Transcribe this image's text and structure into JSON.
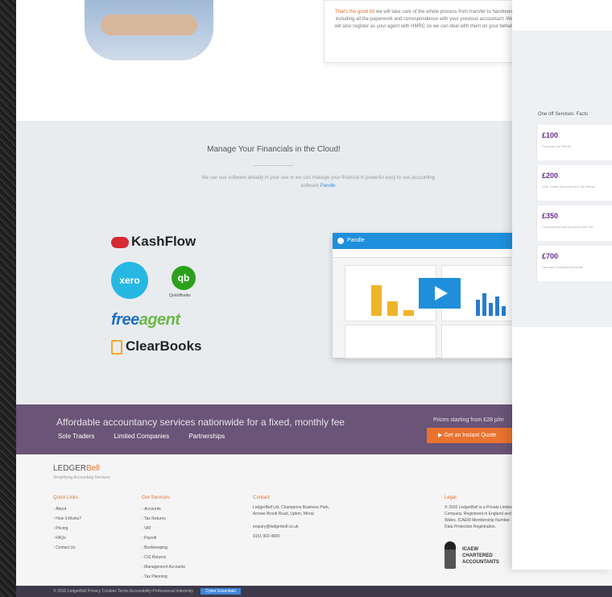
{
  "hero": {
    "quote_highlight": "That's the good bit",
    "quote_text": "we will take care of the whole process from transfer to handover, including all the paperwork and correspondence with your previous accountant. We will also register as your agent with HMRC so we can deal with them on your behalf."
  },
  "cloud": {
    "title": "Manage Your Financials in the Cloud!",
    "text": "We can use software already in your use or we can manage your financial in powerful easy to use accounting software",
    "link": "Pandle"
  },
  "logos": {
    "kashflow": "KashFlow",
    "xero": "xero",
    "quickbooks": "QuickBooks",
    "freeagent_a": "free",
    "freeagent_b": "agent",
    "clearbooks": "ClearBooks"
  },
  "dashboard": {
    "title": "Pandle"
  },
  "banner": {
    "title": "Affordable accountancy services nationwide for a fixed, monthly fee",
    "links": [
      "Sole Traders",
      "Limited Companies",
      "Partnerships"
    ],
    "price_text": "Prices starting from £28 p/m",
    "cta_label": "▶ Get an Instant Quote"
  },
  "footer": {
    "brand_a": "LEDGER",
    "brand_b": "Bell",
    "tagline": "Simplifying Accounting Services",
    "columns": [
      {
        "heading": "Quick Links",
        "items": [
          "About",
          "How it Works?",
          "Pricing",
          "FAQs",
          "Contact Us"
        ]
      },
      {
        "heading": "Our Services",
        "items": [
          "Accounts",
          "Tax Returns",
          "VAT",
          "Payroll",
          "Bookkeeping",
          "CIS Returns",
          "Management Accounts",
          "Tax Planning"
        ]
      }
    ],
    "contact_heading": "Contact",
    "contact_address": "LedgerBell Ltd, Champions Business Park, Arrowe Brook Road, Upton, Wirral",
    "contact_email": "enquiry@ledgerbell.co.uk",
    "contact_phone": "0151 903 4800",
    "legal_heading": "Legal",
    "legal_text": "© 2016 LedgerBell is a Private Limited Company. Registered in England and Wales. ICAEW Membership Number. Data Protection Registration.",
    "icaew_line1": "ICAEW",
    "icaew_line2": "CHARTERED",
    "icaew_line3": "ACCOUNTANTS"
  },
  "bottom_bar": {
    "text": "© 2016 LedgerBell  Privacy  Cookies  Terms  Accessibility  Professional Indemnity",
    "badge": "Cyber Essentials"
  },
  "right_panel": {
    "title": "One off Services: Facts",
    "services": [
      {
        "price": "£100",
        "desc": "Personal Tax Return"
      },
      {
        "price": "£200",
        "desc": "Sole Trader Accounts and Tax Return"
      },
      {
        "price": "£350",
        "desc": "Corporate Annual Accounts and Tax"
      },
      {
        "price": "£700",
        "desc": "Dormant Company Accounts"
      }
    ]
  }
}
